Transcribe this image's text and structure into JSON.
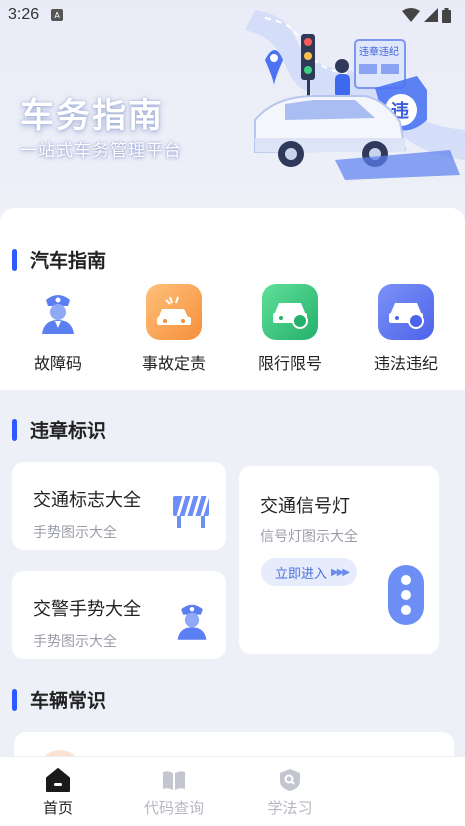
{
  "status_bar": {
    "time": "3:26",
    "sim_label": "A"
  },
  "hero": {
    "title": "车务指南",
    "subtitle": "一站式车务管理平台",
    "sign_text": "违章违纪",
    "badge_text": "违"
  },
  "guide": {
    "heading": "汽车指南",
    "items": [
      {
        "label": "故障码",
        "icon": "police-officer-icon",
        "color": "#6d8ef5"
      },
      {
        "label": "事故定责",
        "icon": "car-crash-icon",
        "color": "#f7a24a"
      },
      {
        "label": "限行限号",
        "icon": "car-restriction-icon",
        "color": "#35c17f"
      },
      {
        "label": "违法违纪",
        "icon": "car-violation-icon",
        "color": "#5b72f2"
      }
    ]
  },
  "violations": {
    "heading": "违章标识",
    "signs": {
      "title": "交通标志大全",
      "subtitle": "手势图示大全"
    },
    "police": {
      "title": "交警手势大全",
      "subtitle": "手势图示大全"
    },
    "lights": {
      "title": "交通信号灯",
      "subtitle": "信号灯图示大全",
      "button": "立即进入"
    }
  },
  "vehicle": {
    "heading": "车辆常识"
  },
  "nav": {
    "items": [
      {
        "label": "首页",
        "active": true
      },
      {
        "label": "代码查询",
        "active": false
      },
      {
        "label": "学法习",
        "active": false
      }
    ]
  },
  "colors": {
    "accent": "#2e5bff",
    "hero_bg": "#e9ecf7"
  }
}
